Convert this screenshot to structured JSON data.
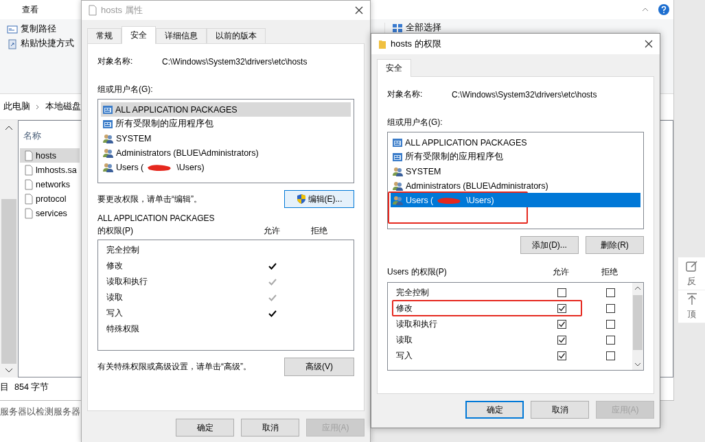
{
  "explorer": {
    "ribbon_tab": "查看",
    "ribbon_items": [
      {
        "kind": "copy-path",
        "label": "复制路径"
      },
      {
        "kind": "paste-shortcut",
        "label": "粘贴快捷方式"
      }
    ],
    "select_all": "全部选择",
    "breadcrumb": [
      "此电脑",
      "本地磁盘"
    ],
    "column_header": "名称",
    "files": [
      {
        "name": "hosts",
        "selected": true
      },
      {
        "name": "lmhosts.sa",
        "selected": false
      },
      {
        "name": "networks",
        "selected": false
      },
      {
        "name": "protocol",
        "selected": false
      },
      {
        "name": "services",
        "selected": false
      }
    ],
    "status_count": "目",
    "status_size": "854 字节"
  },
  "background_window": {
    "text": "服务器以检测服务器"
  },
  "properties_dialog": {
    "title": "hosts 属性",
    "active": false,
    "tabs": [
      {
        "label": "常规",
        "selected": false
      },
      {
        "label": "安全",
        "selected": true
      },
      {
        "label": "详细信息",
        "selected": false
      },
      {
        "label": "以前的版本",
        "selected": false
      }
    ],
    "object_label": "对象名称:",
    "object_path": "C:\\Windows\\System32\\drivers\\etc\\hosts",
    "groups_label": "组或用户名(G):",
    "groups": [
      {
        "kind": "package",
        "name": "ALL APPLICATION PACKAGES",
        "selected": true
      },
      {
        "kind": "package",
        "name": "所有受限制的应用程序包",
        "selected": false
      },
      {
        "kind": "user",
        "name": "SYSTEM",
        "selected": false
      },
      {
        "kind": "user",
        "name": "Administrators (BLUE\\Administrators)",
        "selected": false
      },
      {
        "kind": "user",
        "name": "Users (",
        "name_after": "\\Users)",
        "redacted": true,
        "selected": false
      }
    ],
    "edit_hint": "要更改权限，请单击“编辑”。",
    "edit_button": {
      "label": "编辑(E)...",
      "focused": true
    },
    "permissions_for": "ALL APPLICATION PACKAGES",
    "permissions_label": "的权限(P)",
    "allow_header": "允许",
    "deny_header": "拒绝",
    "permissions": [
      {
        "name": "完全控制",
        "allowed": false
      },
      {
        "name": "修改",
        "allowed": true,
        "inherited": false
      },
      {
        "name": "读取和执行",
        "allowed": true,
        "inherited": true
      },
      {
        "name": "读取",
        "allowed": true,
        "inherited": true
      },
      {
        "name": "写入",
        "allowed": true,
        "inherited": false
      },
      {
        "name": "特殊权限",
        "allowed": false
      }
    ],
    "advanced_hint": "有关特殊权限或高级设置，请单击“高级”。",
    "advanced_button": "高级(V)",
    "buttons": [
      {
        "label": "确定",
        "disabled": false
      },
      {
        "label": "取消",
        "disabled": false
      },
      {
        "label": "应用(A)",
        "disabled": true
      }
    ]
  },
  "permissions_dialog": {
    "title": "hosts 的权限",
    "active": true,
    "tabs": [
      {
        "label": "安全",
        "selected": true
      }
    ],
    "object_label": "对象名称:",
    "object_path": "C:\\Windows\\System32\\drivers\\etc\\hosts",
    "groups_label": "组或用户名(G):",
    "groups": [
      {
        "kind": "package",
        "name": "ALL APPLICATION PACKAGES",
        "selected": false
      },
      {
        "kind": "package",
        "name": "所有受限制的应用程序包",
        "selected": false
      },
      {
        "kind": "user",
        "name": "SYSTEM",
        "selected": false
      },
      {
        "kind": "user",
        "name": "Administrators (BLUE\\Administrators)",
        "selected": false
      },
      {
        "kind": "user",
        "name": "Users (",
        "name_after": "\\Users)",
        "redacted": true,
        "selected": true,
        "annotated": true
      }
    ],
    "add_button": "添加(D)...",
    "remove_button": "删除(R)",
    "permissions_label": "Users 的权限(P)",
    "allow_header": "允许",
    "deny_header": "拒绝",
    "permissions": [
      {
        "name": "完全控制",
        "allow": false,
        "deny": false,
        "annotated": false
      },
      {
        "name": "修改",
        "allow": true,
        "deny": false,
        "annotated": true
      },
      {
        "name": "读取和执行",
        "allow": true,
        "deny": false,
        "annotated": false
      },
      {
        "name": "读取",
        "allow": true,
        "deny": false,
        "annotated": false
      },
      {
        "name": "写入",
        "allow": true,
        "deny": false,
        "annotated": false
      }
    ],
    "buttons": [
      {
        "label": "确定",
        "default": true,
        "disabled": false
      },
      {
        "label": "取消",
        "default": false,
        "disabled": false
      },
      {
        "label": "应用(A)",
        "default": false,
        "disabled": true
      }
    ]
  },
  "side_panel": {
    "items": [
      {
        "kind": "feedback",
        "label": "反"
      },
      {
        "kind": "top",
        "label": "顶"
      }
    ]
  }
}
